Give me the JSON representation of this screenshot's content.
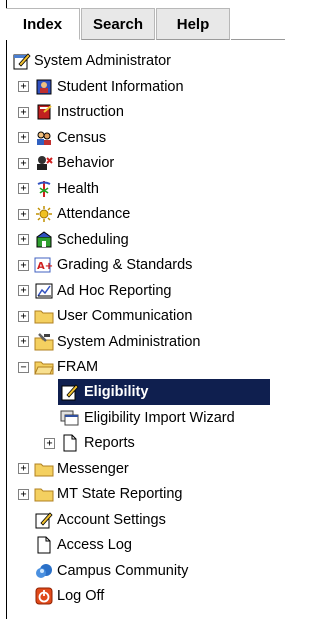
{
  "tabs": [
    {
      "label": "Index",
      "active": true
    },
    {
      "label": "Search",
      "active": false
    },
    {
      "label": "Help",
      "active": false
    }
  ],
  "tree": [
    {
      "id": "root",
      "label": "System Administrator",
      "icon": "edit-icon",
      "level": 0,
      "expander": "none"
    },
    {
      "id": "student-information",
      "label": "Student Information",
      "icon": "student-icon",
      "level": 1,
      "expander": "+"
    },
    {
      "id": "instruction",
      "label": "Instruction",
      "icon": "book-icon",
      "level": 1,
      "expander": "+"
    },
    {
      "id": "census",
      "label": "Census",
      "icon": "census-icon",
      "level": 1,
      "expander": "+"
    },
    {
      "id": "behavior",
      "label": "Behavior",
      "icon": "behavior-icon",
      "level": 1,
      "expander": "+"
    },
    {
      "id": "health",
      "label": "Health",
      "icon": "caduceus-icon",
      "level": 1,
      "expander": "+"
    },
    {
      "id": "attendance",
      "label": "Attendance",
      "icon": "attendance-icon",
      "level": 1,
      "expander": "+"
    },
    {
      "id": "scheduling",
      "label": "Scheduling",
      "icon": "scheduling-icon",
      "level": 1,
      "expander": "+"
    },
    {
      "id": "grading-standards",
      "label": "Grading & Standards",
      "icon": "grade-icon",
      "level": 1,
      "expander": "+"
    },
    {
      "id": "ad-hoc-reporting",
      "label": "Ad Hoc Reporting",
      "icon": "chart-icon",
      "level": 1,
      "expander": "+"
    },
    {
      "id": "user-communication",
      "label": "User Communication",
      "icon": "folder-icon",
      "level": 1,
      "expander": "+"
    },
    {
      "id": "system-administration",
      "label": "System Administration",
      "icon": "folder-tools-icon",
      "level": 1,
      "expander": "+"
    },
    {
      "id": "fram",
      "label": "FRAM",
      "icon": "folder-open-icon",
      "level": 1,
      "expander": "−"
    },
    {
      "id": "eligibility",
      "label": "Eligibility",
      "icon": "edit-icon",
      "level": 2,
      "expander": "none",
      "selected": true
    },
    {
      "id": "eligibility-import-wizard",
      "label": "Eligibility Import Wizard",
      "icon": "wizard-icon",
      "level": 2,
      "expander": "none"
    },
    {
      "id": "reports",
      "label": "Reports",
      "icon": "document-icon",
      "level": 2,
      "expander": "+"
    },
    {
      "id": "messenger",
      "label": "Messenger",
      "icon": "folder-icon",
      "level": 1,
      "expander": "+"
    },
    {
      "id": "mt-state-reporting",
      "label": "MT State Reporting",
      "icon": "folder-icon",
      "level": 1,
      "expander": "+"
    },
    {
      "id": "account-settings",
      "label": "Account Settings",
      "icon": "edit-icon",
      "level": 1,
      "expander": "none"
    },
    {
      "id": "access-log",
      "label": "Access Log",
      "icon": "document-icon",
      "level": 1,
      "expander": "none"
    },
    {
      "id": "campus-community",
      "label": "Campus Community",
      "icon": "community-icon",
      "level": 1,
      "expander": "none"
    },
    {
      "id": "log-off",
      "label": "Log Off",
      "icon": "power-icon",
      "level": 1,
      "expander": "none"
    }
  ],
  "colors": {
    "selection": "#0f1f4f",
    "folder": "#f4d060"
  }
}
